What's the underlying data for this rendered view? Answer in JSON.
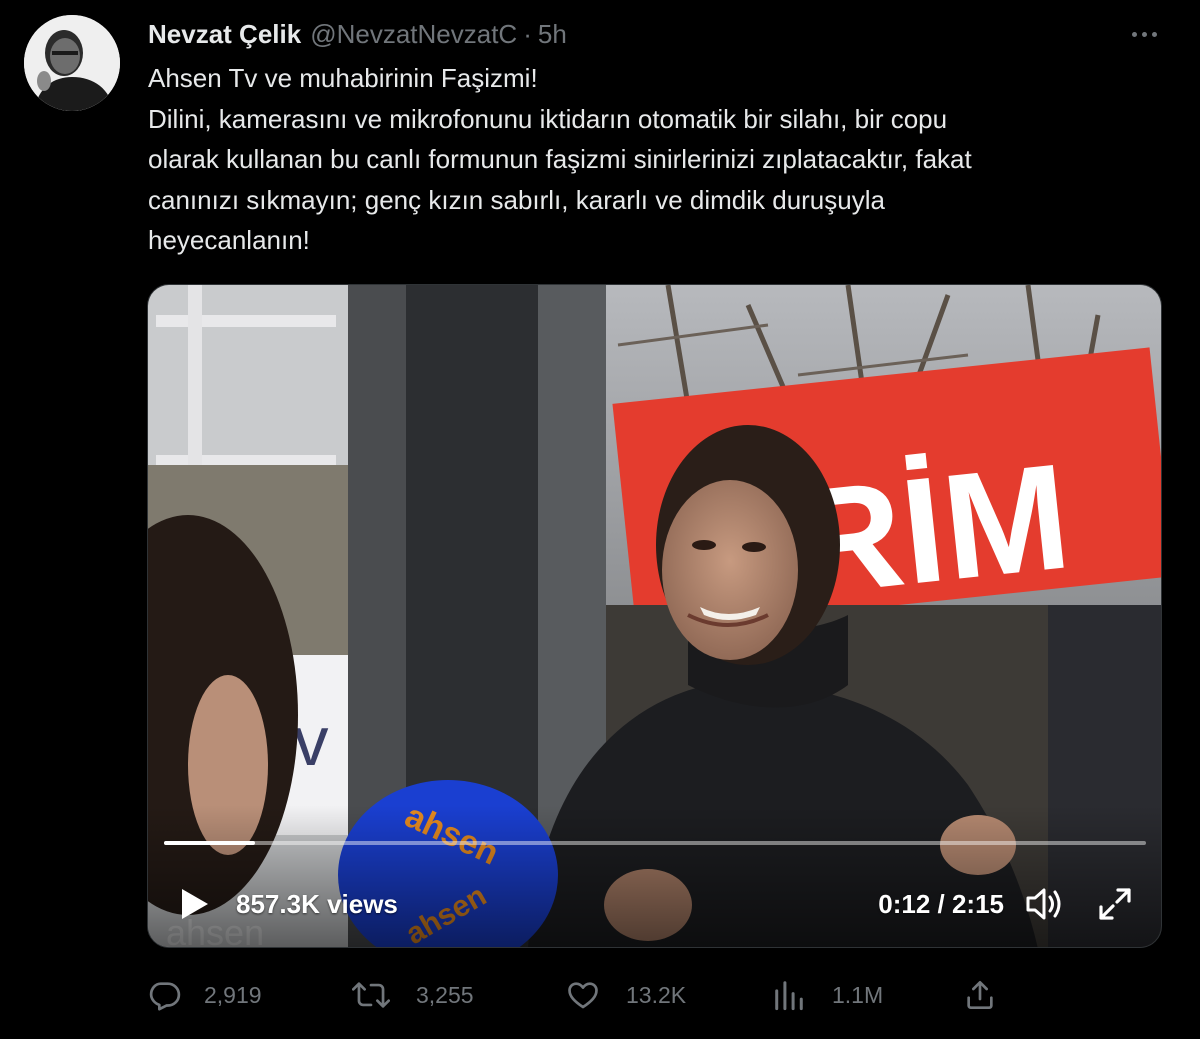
{
  "tweet": {
    "author": {
      "name": "Nevzat Çelik",
      "handle": "@NevzatNevzatC",
      "separator": "·",
      "time": "5h"
    },
    "text_lines": [
      "Ahsen Tv ve muhabirinin Faşizmi!",
      "Dilini, kamerasını ve mikrofonunu iktidarın otomatik bir silahı, bir copu",
      "olarak kullanan bu canlı formunun faşizmi sinirlerinizi zıplatacaktır, fakat",
      "canınızı sıkmayın; genç kızın sabırlı, kararlı ve dimdik duruşuyla",
      "heyecanlanın!"
    ],
    "video": {
      "views": "857.3K views",
      "timecode": "0:12 / 2:15",
      "progress_fraction": 0.093
    },
    "actions": {
      "replies": "2,919",
      "retweets": "3,255",
      "likes": "13.2K",
      "views": "1.1M"
    }
  },
  "icons": {
    "more": "more-horizontal-icon",
    "play": "play-icon",
    "volume": "volume-icon",
    "fullscreen": "fullscreen-icon",
    "reply": "reply-icon",
    "retweet": "retweet-icon",
    "like": "heart-icon",
    "analytics": "analytics-icon",
    "share": "share-icon"
  },
  "colors": {
    "background": "#000000",
    "text_primary": "#e7e9ea",
    "text_secondary": "#71767b"
  }
}
